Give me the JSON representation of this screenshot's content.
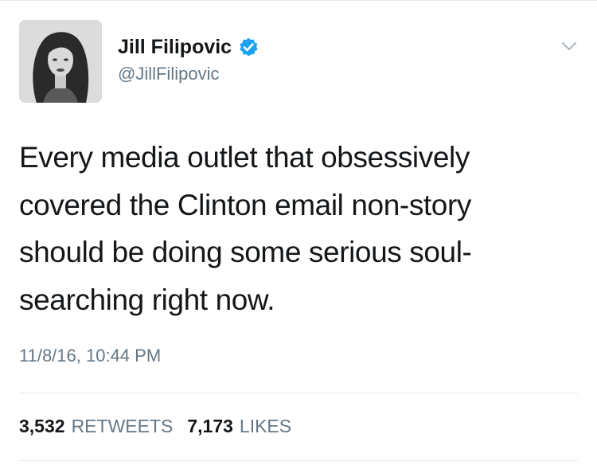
{
  "author": {
    "display_name": "Jill Filipovic",
    "handle": "@JillFilipovic",
    "verified": true,
    "avatar_icon": "profile-photo"
  },
  "tweet": {
    "text_lines": [
      "Every media outlet that obsessively",
      "covered the Clinton email non-story",
      "should be doing some serious soul-",
      "searching right now."
    ],
    "timestamp": "11/8/16, 10:44 PM"
  },
  "stats": {
    "retweets_count": "3,532",
    "retweets_label": "RETWEETS",
    "likes_count": "7,173",
    "likes_label": "LIKES"
  },
  "icons": {
    "verified": "verified-badge-icon",
    "menu": "chevron-down-icon"
  },
  "colors": {
    "text": "#14171a",
    "secondary": "#657786",
    "verified_blue": "#1da1f2",
    "divider": "#e1e8ed"
  }
}
